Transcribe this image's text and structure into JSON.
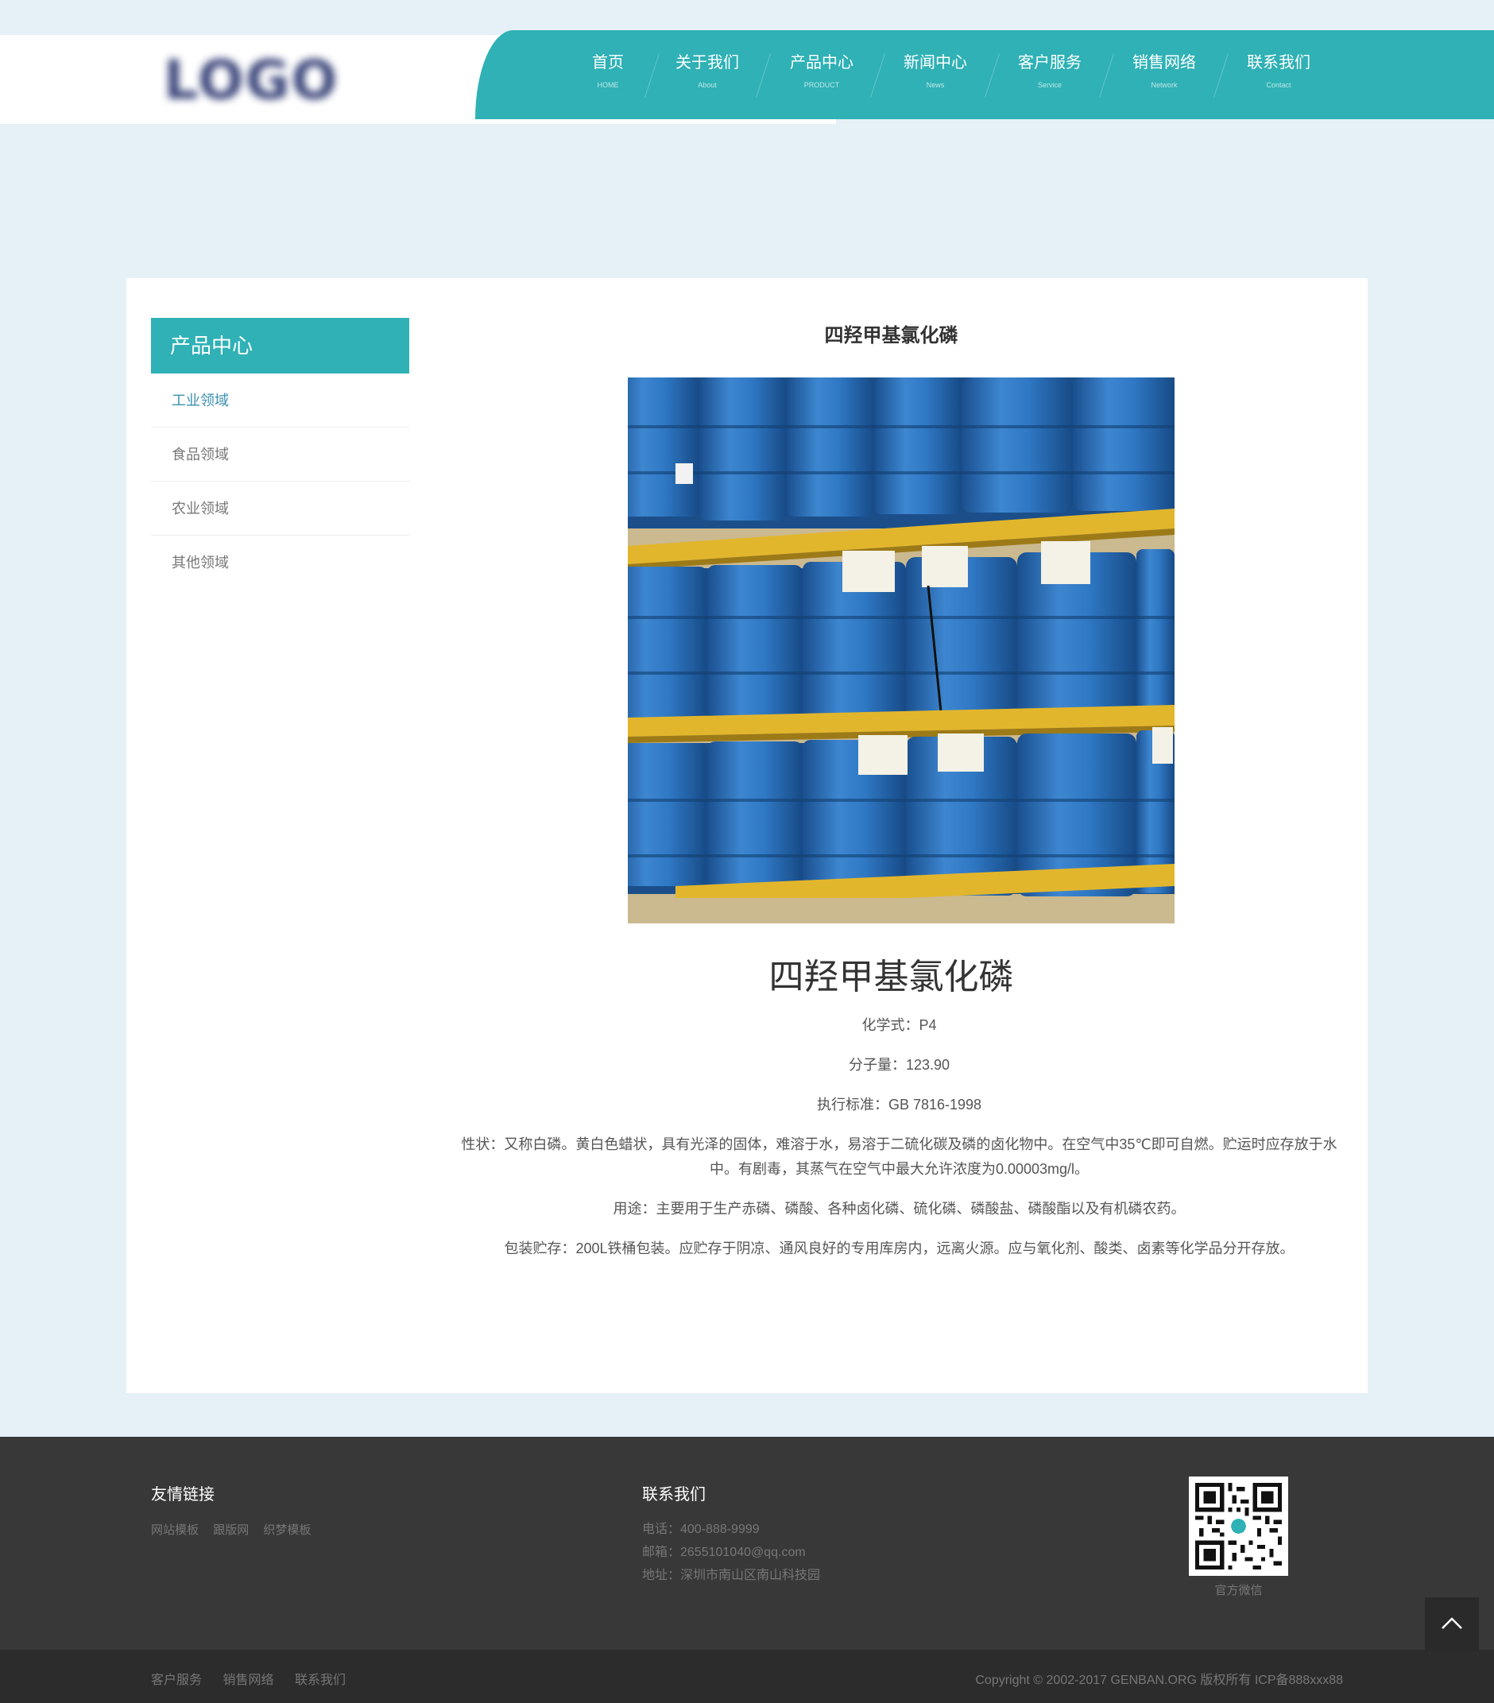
{
  "header": {
    "logo_text": "LOGO",
    "nav": [
      {
        "cn": "首页",
        "en": "HOME"
      },
      {
        "cn": "关于我们",
        "en": "About"
      },
      {
        "cn": "产品中心",
        "en": "PRODUCT"
      },
      {
        "cn": "新闻中心",
        "en": "News"
      },
      {
        "cn": "客户服务",
        "en": "Service"
      },
      {
        "cn": "销售网络",
        "en": "Network"
      },
      {
        "cn": "联系我们",
        "en": "Contact"
      }
    ]
  },
  "sidebar": {
    "title": "产品中心",
    "items": [
      {
        "label": "工业领域"
      },
      {
        "label": "食品领域"
      },
      {
        "label": "农业领域"
      },
      {
        "label": "其他领域"
      }
    ]
  },
  "product": {
    "title": "四羟甲基氯化磷",
    "name": "四羟甲基氯化磷",
    "formula": "化学式：P4",
    "weight": "分子量：123.90",
    "standard": "执行标准：GB 7816-1998",
    "property": "性状：又称白磷。黄白色蜡状，具有光泽的固体，难溶于水，易溶于二硫化碳及磷的卤化物中。在空气中35℃即可自燃。贮运时应存放于水中。有剧毒，其蒸气在空气中最大允许浓度为0.00003mg/l。",
    "usage": "用途：主要用于生产赤磷、磷酸、各种卤化磷、硫化磷、磷酸盐、磷酸酯以及有机磷农药。",
    "package": "包装贮存：200L铁桶包装。应贮存于阴凉、通风良好的专用库房内，远离火源。应与氧化剂、酸类、卤素等化学品分开存放。"
  },
  "footer": {
    "links_title": "友情链接",
    "links": [
      "网站模板",
      "跟版网",
      "织梦模板"
    ],
    "contact_title": "联系我们",
    "phone": "电话：400-888-9999",
    "email": "邮箱：2655101040@qq.com",
    "address": "地址：深圳市南山区南山科技园",
    "qr_caption": "官方微信",
    "bottom_links": [
      "客户服务",
      "销售网络",
      "联系我们"
    ],
    "copyright": "Copyright © 2002-2017 GENBAN.ORG 版权所有    ICP备888xxx88"
  },
  "colors": {
    "accent": "#2fb1b5",
    "page_bg": "#e6f1f7",
    "footer_bg": "#383838",
    "bottom_bg": "#2c2c2c",
    "barrel_blue": "#2a6fb8",
    "pallet_yellow": "#e2b62c"
  },
  "icons": {
    "back_to_top": "chevron-up-icon",
    "qr": "qr-code-icon"
  }
}
